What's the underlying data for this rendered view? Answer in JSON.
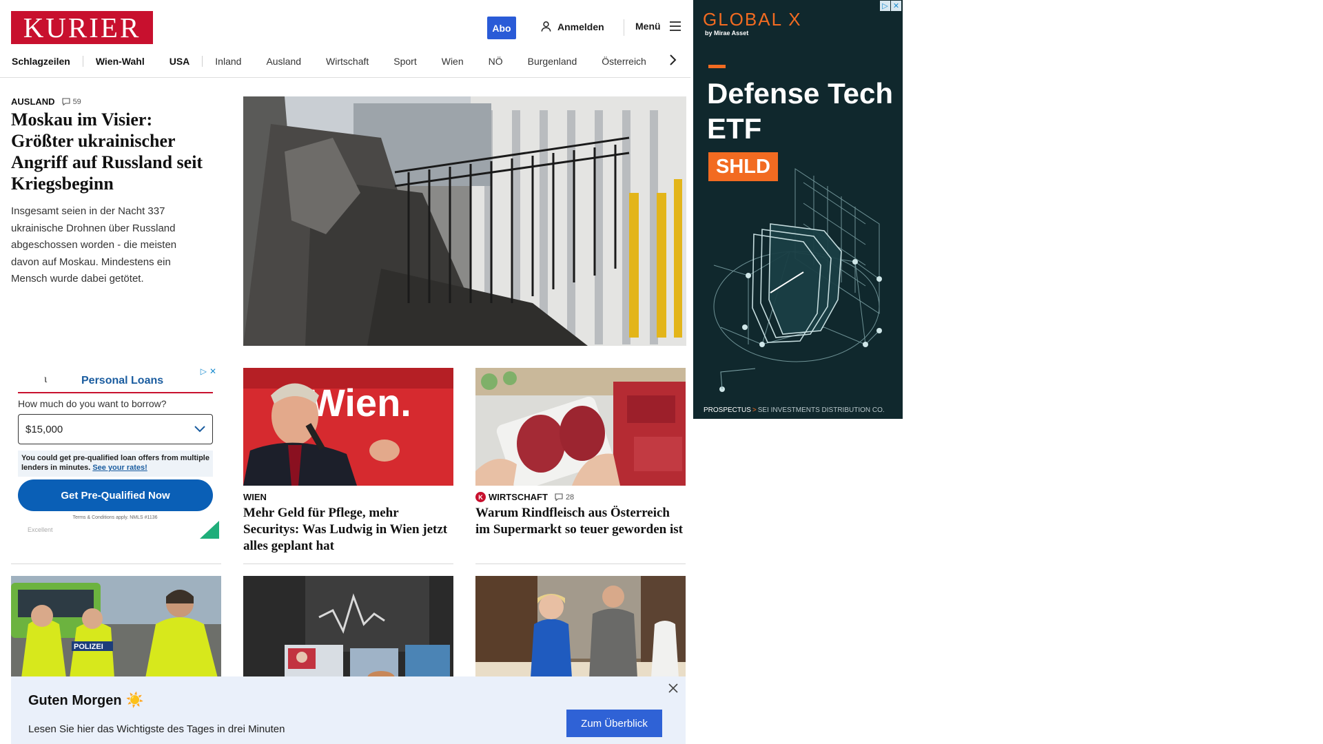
{
  "header": {
    "logo_text": "KURIER",
    "abo_label": "Abo",
    "login_label": "Anmelden",
    "menu_label": "Menü"
  },
  "nav": {
    "items": [
      {
        "label": "Schlagzeilen"
      },
      {
        "label": "Wien-Wahl"
      },
      {
        "label": "USA"
      },
      {
        "label": "Inland"
      },
      {
        "label": "Ausland"
      },
      {
        "label": "Wirtschaft"
      },
      {
        "label": "Sport"
      },
      {
        "label": "Wien"
      },
      {
        "label": "NÖ"
      },
      {
        "label": "Burgenland"
      },
      {
        "label": "Österreich"
      }
    ]
  },
  "lead": {
    "category": "AUSLAND",
    "comment_count": "59",
    "title": "Moskau im Visier: Größter ukrainischer Angriff auf Russland seit Kriegsbeginn",
    "teaser": "Insgesamt seien in der Nacht 337 ukrainische Drohnen über Russland abgeschossen worden - die meisten davon auf Moskau. Mindestens ein Mensch wurde dabei getötet."
  },
  "loan_ad": {
    "logo": "ι",
    "title": "Personal Loans",
    "question": "How much do you want to borrow?",
    "selected_amount": "$15,000",
    "info_text": "You could get pre-qualified loan offers from multiple lenders in minutes.",
    "info_link": "See your rates!",
    "cta_label": "Get Pre-Qualified Now",
    "terms": "Terms & Conditions apply. NMLS #1136",
    "rating_label": "Excellent"
  },
  "cards": [
    {
      "category": "WIEN",
      "title": "Mehr Geld für Pflege, mehr Securitys: Was Ludwig in Wien jetzt alles geplant hat",
      "image_text": "Wien."
    },
    {
      "category": "WIRTSCHAFT",
      "badge": "K",
      "comment_count": "28",
      "title": "Warum Rindfleisch aus Österreich im Supermarkt so teuer geworden ist"
    }
  ],
  "bottom_images": {
    "police_label": "POLIZEI"
  },
  "right_ad": {
    "brand": "GLOBAL X",
    "brand_sub": "by Mirae Asset",
    "headline": "Defense Tech ETF",
    "ticker": "SHLD",
    "footer_link": "PROSPECTUS",
    "footer_text": "SEI INVESTMENTS DISTRIBUTION CO."
  },
  "banner": {
    "title": "Guten Morgen",
    "sun": "☀️",
    "text": "Lesen Sie hier das Wichtigste des Tages in drei Minuten",
    "button": "Zum Überblick"
  },
  "colors": {
    "brand_red": "#c8102e",
    "accent_blue": "#2a5bd7",
    "ad_orange": "#f26b21",
    "ad_bg": "#10282d"
  }
}
